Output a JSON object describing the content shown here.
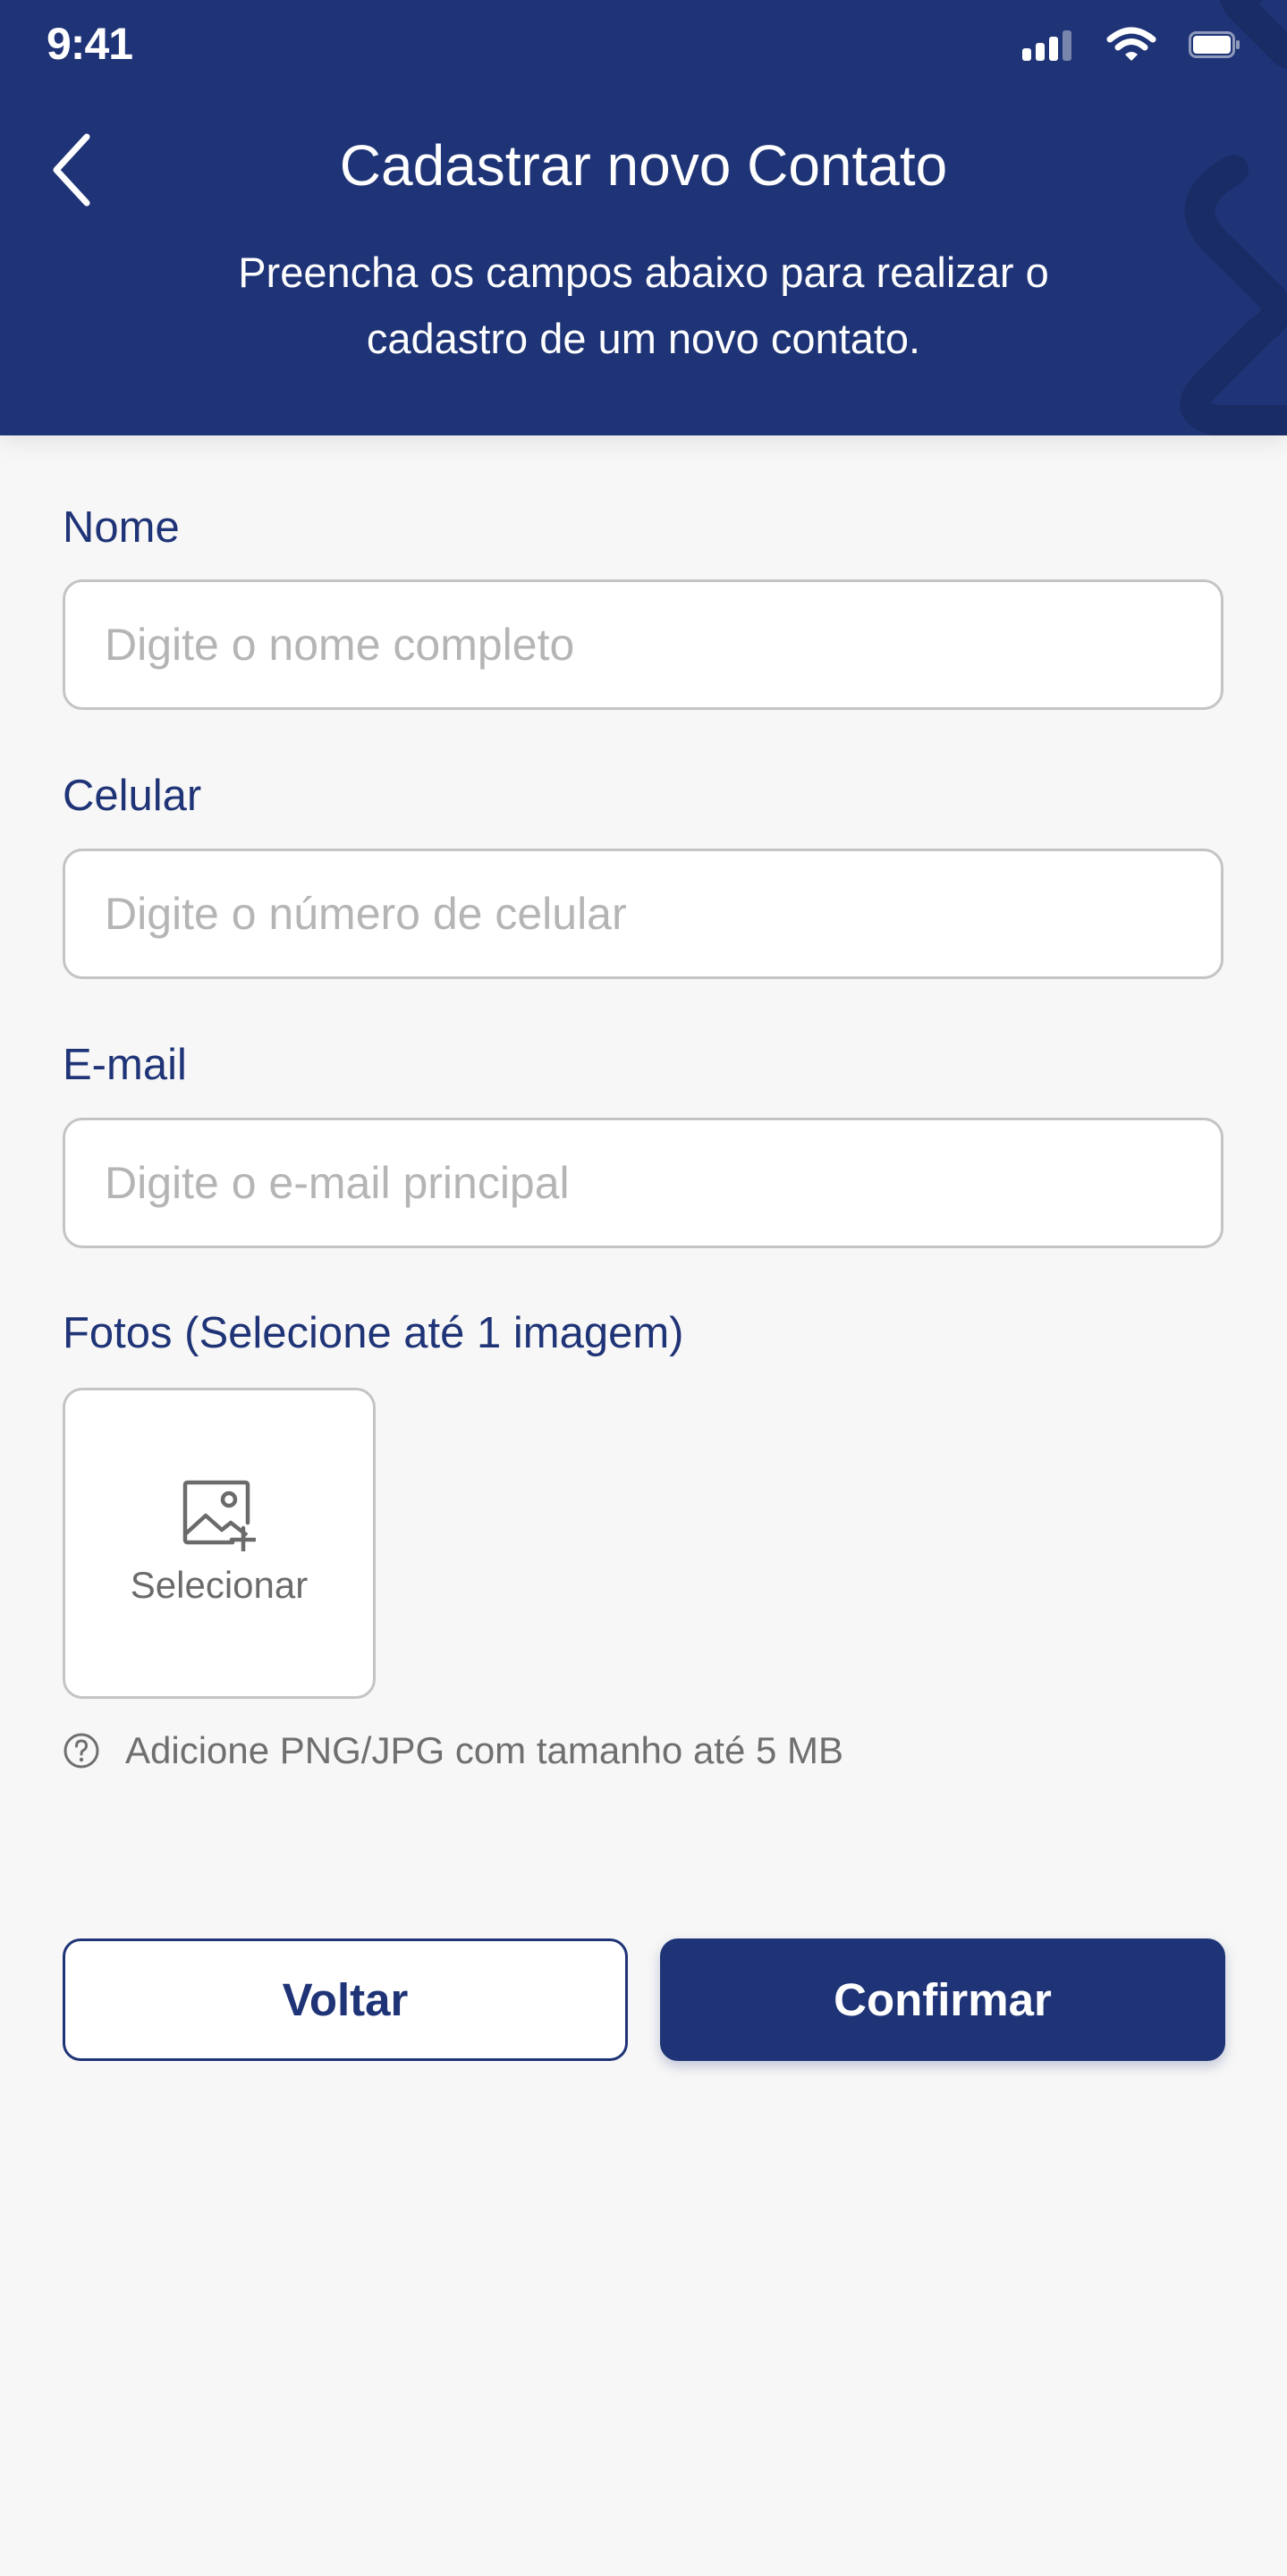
{
  "status_bar": {
    "time": "9:41"
  },
  "header": {
    "title": "Cadastrar novo Contato",
    "subtitle": "Preencha os campos abaixo para realizar o cadastro de um novo contato.",
    "back_icon": "chevron-left-icon"
  },
  "form": {
    "name": {
      "label": "Nome",
      "placeholder": "Digite o nome completo",
      "value": ""
    },
    "phone": {
      "label": "Celular",
      "placeholder": "Digite o número de celular",
      "value": ""
    },
    "email": {
      "label": "E-mail",
      "placeholder": "Digite o e-mail principal",
      "value": ""
    },
    "photos": {
      "label": "Fotos (Selecione até 1 imagem)",
      "select_label": "Selecionar",
      "icon": "add-image-icon",
      "hint": "Adicione PNG/JPG com tamanho até 5 MB",
      "hint_icon": "question-circle-icon"
    }
  },
  "actions": {
    "back_label": "Voltar",
    "confirm_label": "Confirmar"
  },
  "colors": {
    "primary": "#1f3477",
    "background": "#f7f7f7",
    "input_border": "#c4c4c4",
    "placeholder": "#b5b5b5"
  }
}
